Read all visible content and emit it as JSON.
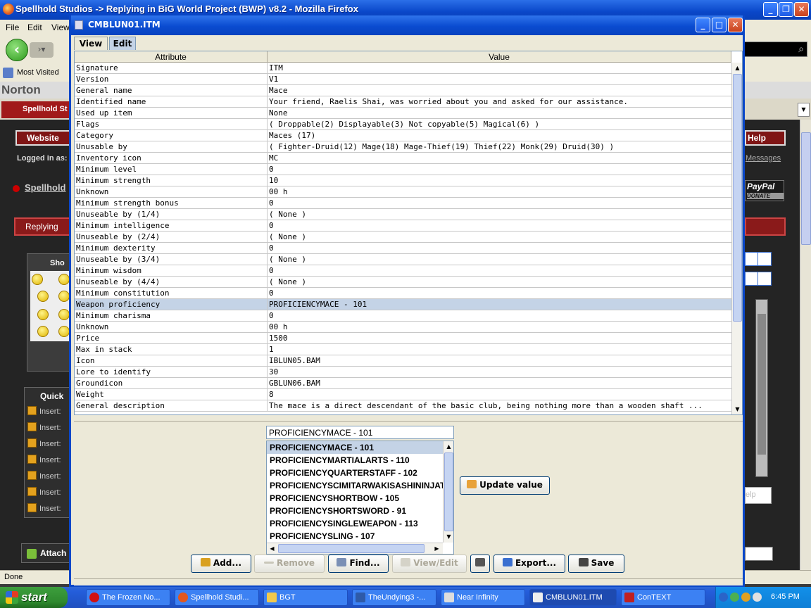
{
  "firefox": {
    "title": "Spellhold Studios -> Replying in BiG World Project (BWP) v8.2 - Mozilla Firefox",
    "menu": [
      "File",
      "Edit",
      "View"
    ],
    "bookmarks": [
      "Most Visited"
    ],
    "toolbar_brand": "Norton",
    "tab_label": "Spellhold St",
    "status": "Done"
  },
  "site": {
    "website_btn": "Website",
    "help_btn": "Help",
    "logged_in": "Logged in as:",
    "messages": "Messages",
    "spellhold_link": "Spellhold",
    "replying": "Replying",
    "paypal": "PayPal",
    "paypal_sub": "DONATE",
    "smiley_header": "Sho",
    "quick_header": "Quick",
    "insert_items": [
      "Insert:",
      "Insert:",
      "Insert:",
      "Insert:",
      "Insert:",
      "Insert:",
      "Insert:"
    ],
    "attach": "Attach",
    "help_box": "elp"
  },
  "dialog": {
    "title": "CMBLUN01.ITM",
    "tabs": [
      "View",
      "Edit"
    ],
    "columns": [
      "Attribute",
      "Value"
    ],
    "rows": [
      {
        "attr": "Signature",
        "value": "ITM"
      },
      {
        "attr": "Version",
        "value": "V1"
      },
      {
        "attr": "General name",
        "value": "Mace"
      },
      {
        "attr": "Identified name",
        "value": "Your friend, Raelis Shai, was worried about you and asked for our assistance."
      },
      {
        "attr": "Used up item",
        "value": "None"
      },
      {
        "attr": "Flags",
        "value": "( Droppable(2) Displayable(3) Not copyable(5) Magical(6) )"
      },
      {
        "attr": "Category",
        "value": "Maces (17)"
      },
      {
        "attr": "Unusable by",
        "value": "( Fighter-Druid(12) Mage(18) Mage-Thief(19) Thief(22) Monk(29) Druid(30) )"
      },
      {
        "attr": "Inventory icon",
        "value": "MC"
      },
      {
        "attr": "Minimum level",
        "value": "0"
      },
      {
        "attr": "Minimum strength",
        "value": "10"
      },
      {
        "attr": "Unknown",
        "value": "00 h"
      },
      {
        "attr": "Minimum strength bonus",
        "value": "0"
      },
      {
        "attr": "Unuseable by (1/4)",
        "value": "( None )"
      },
      {
        "attr": "Minimum intelligence",
        "value": "0"
      },
      {
        "attr": "Unuseable by (2/4)",
        "value": "( None )"
      },
      {
        "attr": "Minimum dexterity",
        "value": "0"
      },
      {
        "attr": "Unuseable by (3/4)",
        "value": "( None )"
      },
      {
        "attr": "Minimum wisdom",
        "value": "0"
      },
      {
        "attr": "Unuseable by (4/4)",
        "value": "( None )"
      },
      {
        "attr": "Minimum constitution",
        "value": "0"
      },
      {
        "attr": "Weapon proficiency",
        "value": "PROFICIENCYMACE - 101",
        "selected": true
      },
      {
        "attr": "Minimum charisma",
        "value": "0"
      },
      {
        "attr": "Unknown",
        "value": "00 h"
      },
      {
        "attr": "Price",
        "value": "1500"
      },
      {
        "attr": "Max in stack",
        "value": "1"
      },
      {
        "attr": "Icon",
        "value": "IBLUN05.BAM"
      },
      {
        "attr": "Lore to identify",
        "value": "30"
      },
      {
        "attr": "Groundicon",
        "value": "GBLUN06.BAM"
      },
      {
        "attr": "Weight",
        "value": "8"
      },
      {
        "attr": "General description",
        "value": "The mace is a direct descendant of the basic club, being nothing more than a wooden shaft ..."
      }
    ],
    "edit": {
      "current_value": "PROFICIENCYMACE - 101",
      "options": [
        "PROFICIENCYMACE - 101",
        "PROFICIENCYMARTIALARTS - 110",
        "PROFICIENCYQUARTERSTAFF - 102",
        "PROFICIENCYSCIMITARWAKISASHININJATO",
        "PROFICIENCYSHORTBOW - 105",
        "PROFICIENCYSHORTSWORD - 91",
        "PROFICIENCYSINGLEWEAPON - 113",
        "PROFICIENCYSLING - 107"
      ],
      "update_label": "Update value"
    },
    "buttons": {
      "add": "Add...",
      "remove": "Remove",
      "find": "Find...",
      "view_edit": "View/Edit",
      "export": "Export...",
      "save": "Save"
    }
  },
  "taskbar": {
    "start": "start",
    "items": [
      "The Frozen No...",
      "Spellhold Studi...",
      "BGT",
      "TheUndying3 -...",
      "Near Infinity",
      "CMBLUN01.ITM",
      "ConTEXT"
    ],
    "time": "6:45 PM"
  },
  "colors": {
    "xp_blue": "#0a47c9",
    "selection": "#c4d3e6",
    "site_red": "#7f1515"
  }
}
